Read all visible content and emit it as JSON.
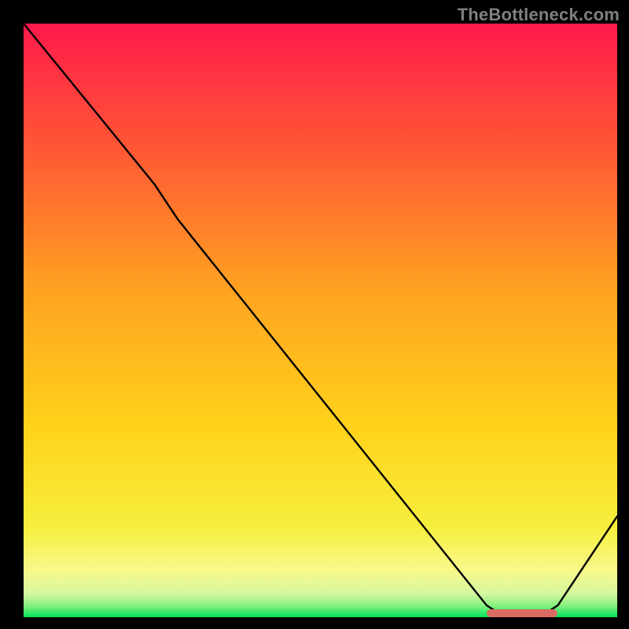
{
  "watermark": "TheBottleneck.com",
  "chart_data": {
    "type": "line",
    "title": "",
    "xlabel": "",
    "ylabel": "",
    "xlim": [
      0,
      100
    ],
    "ylim": [
      0,
      100
    ],
    "grid": false,
    "background_gradient": {
      "top": "#ff1a4b",
      "upper_mid": "#ff7b2f",
      "mid": "#ffd21a",
      "lower_mid": "#f9f75c",
      "bottom_band": "#e4fbb0",
      "bottom": "#00e35a"
    },
    "series": [
      {
        "name": "curve",
        "color": "#000000",
        "points": [
          {
            "x": 0,
            "y": 100
          },
          {
            "x": 22,
            "y": 73
          },
          {
            "x": 26,
            "y": 67
          },
          {
            "x": 78,
            "y": 2
          },
          {
            "x": 80,
            "y": 0.7
          },
          {
            "x": 88,
            "y": 0.7
          },
          {
            "x": 90,
            "y": 2
          },
          {
            "x": 100,
            "y": 17
          }
        ]
      }
    ],
    "marker": {
      "name": "highlight-segment",
      "color": "#da6b63",
      "x_start": 78,
      "x_end": 90,
      "y": 0.7
    }
  }
}
